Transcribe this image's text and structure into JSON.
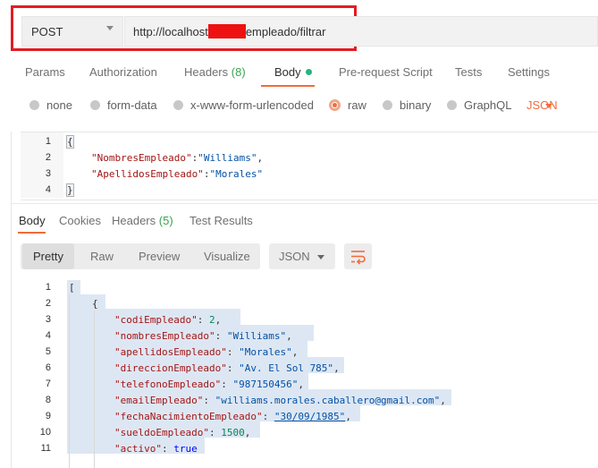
{
  "request": {
    "method": "POST",
    "url_start": "http://localhost",
    "url_end": "empleado/filtrar"
  },
  "request_tabs": {
    "params": "Params",
    "authorization": "Authorization",
    "headers": "Headers",
    "headers_count": "(8)",
    "body": "Body",
    "prerequest": "Pre-request Script",
    "tests": "Tests",
    "settings": "Settings"
  },
  "body_types": {
    "none": "none",
    "form_data": "form-data",
    "urlencoded": "x-www-form-urlencoded",
    "raw": "raw",
    "binary": "binary",
    "graphql": "GraphQL",
    "language": "JSON"
  },
  "request_body": {
    "line_numbers": [
      "1",
      "2",
      "3",
      "4"
    ],
    "line1": "{",
    "line2_key": "\"NombresEmpleado\"",
    "line2_sep": ":",
    "line2_val": "\"Williams\"",
    "line2_end": ",",
    "line3_key": "\"ApellidosEmpleado\"",
    "line3_sep": ":",
    "line3_val": "\"Morales\"",
    "line4": "}"
  },
  "response_tabs": {
    "body": "Body",
    "cookies": "Cookies",
    "headers": "Headers",
    "headers_count": "(5)",
    "test_results": "Test Results"
  },
  "response_toolbar": {
    "pretty": "Pretty",
    "raw": "Raw",
    "preview": "Preview",
    "visualize": "Visualize",
    "format": "JSON"
  },
  "response_body": {
    "line_numbers": [
      "1",
      "2",
      "3",
      "4",
      "5",
      "6",
      "7",
      "8",
      "9",
      "10",
      "11"
    ],
    "l1": "[",
    "l2": "{",
    "l3_key": "\"codiEmpleado\"",
    "l3_val": "2",
    "l4_key": "\"nombresEmpleado\"",
    "l4_val": "\"Williams\"",
    "l5_key": "\"apellidosEmpleado\"",
    "l5_val": "\"Morales\"",
    "l6_key": "\"direccionEmpleado\"",
    "l6_val": "\"Av. El Sol 785\"",
    "l7_key": "\"telefonoEmpleado\"",
    "l7_val": "\"987150456\"",
    "l8_key": "\"emailEmpleado\"",
    "l8_val": "\"williams.morales.caballero@gmail.com\"",
    "l9_key": "\"fechaNacimientoEmpleado\"",
    "l9_val": "\"30/09/1985\"",
    "l10_key": "\"sueldoEmpleado\"",
    "l10_val": "1500",
    "l11_key": "\"activo\"",
    "l11_val": "true",
    "colon": ": ",
    "comma": ","
  }
}
